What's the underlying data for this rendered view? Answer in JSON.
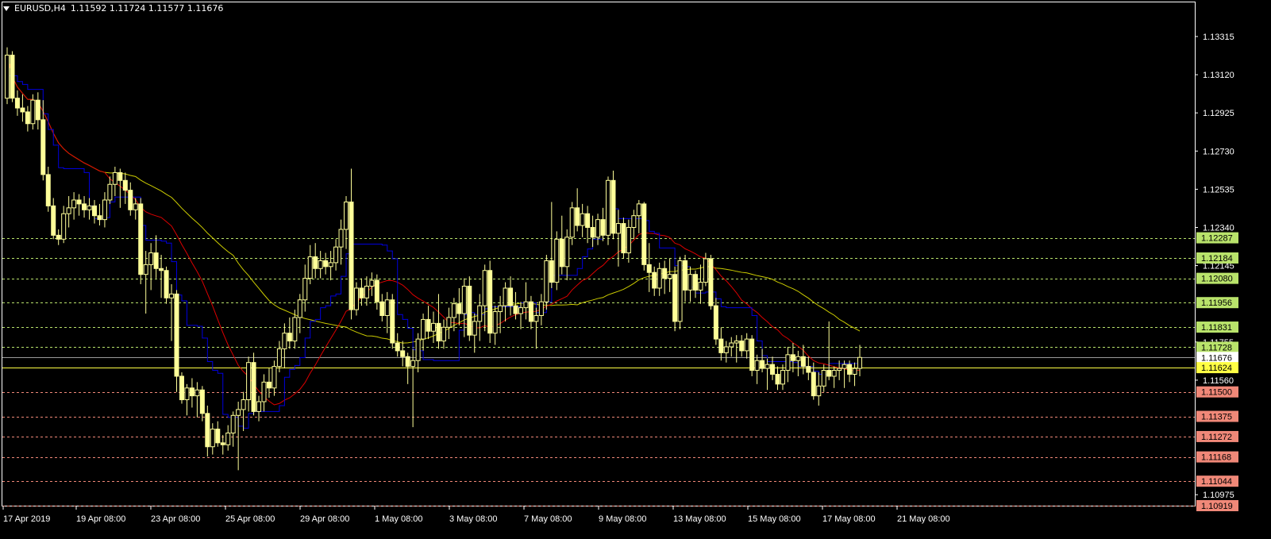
{
  "header": {
    "symbol": "EURUSD,H4",
    "ohlc": "1.11592 1.11724 1.11577 1.11676"
  },
  "colors": {
    "background": "#000000",
    "frame": "#ffffff",
    "candle": "#ffff99",
    "ma_fast": "#0000dd",
    "ma_mid": "#dd0000",
    "ma_slow": "#cccc00",
    "resistance": "#b9e36b",
    "support": "#f08878",
    "current_price": "#ffffff",
    "bid_line": "#ffff44"
  },
  "chart_data": {
    "type": "candlestick",
    "symbol": "EURUSD",
    "timeframe": "H4",
    "ylim": [
      1.10919,
      1.13315
    ],
    "grid": false,
    "price_axis_ticks": [
      "1.13315",
      "1.13120",
      "1.12925",
      "1.12730",
      "1.12535",
      "1.12340",
      "1.12145",
      "1.11755",
      "1.11560",
      "1.10975"
    ],
    "time_axis_labels": [
      "17 Apr 2019",
      "19 Apr 08:00",
      "23 Apr 08:00",
      "25 Apr 08:00",
      "29 Apr 08:00",
      "1 May 08:00",
      "3 May 08:00",
      "7 May 08:00",
      "9 May 08:00",
      "13 May 08:00",
      "15 May 08:00",
      "17 May 08:00",
      "21 May 08:00"
    ],
    "resistance_levels": [
      "1.12287",
      "1.12184",
      "1.12080",
      "1.11956",
      "1.11831",
      "1.11728"
    ],
    "support_levels": [
      "1.11500",
      "1.11375",
      "1.11272",
      "1.11168",
      "1.11044",
      "1.10919"
    ],
    "current_price": "1.11676",
    "bid_line": "1.11624",
    "candles": [
      [
        1.13,
        1.1326,
        1.1297,
        1.1322
      ],
      [
        1.1322,
        1.1324,
        1.1298,
        1.13
      ],
      [
        1.13,
        1.1304,
        1.1291,
        1.1295
      ],
      [
        1.1295,
        1.1302,
        1.1288,
        1.1293
      ],
      [
        1.1293,
        1.1296,
        1.1283,
        1.1287
      ],
      [
        1.1287,
        1.1302,
        1.1284,
        1.1299
      ],
      [
        1.1299,
        1.1303,
        1.1284,
        1.1289
      ],
      [
        1.1289,
        1.1299,
        1.1258,
        1.1261
      ],
      [
        1.1261,
        1.1265,
        1.1242,
        1.1245
      ],
      [
        1.1245,
        1.1249,
        1.1228,
        1.123
      ],
      [
        1.123,
        1.1233,
        1.1225,
        1.1228
      ],
      [
        1.1228,
        1.1245,
        1.1226,
        1.1241
      ],
      [
        1.1241,
        1.125,
        1.1234,
        1.1244
      ],
      [
        1.1244,
        1.1252,
        1.1238,
        1.1248
      ],
      [
        1.1248,
        1.1251,
        1.124,
        1.1246
      ],
      [
        1.1246,
        1.125,
        1.1239,
        1.1243
      ],
      [
        1.1243,
        1.1249,
        1.1238,
        1.1245
      ],
      [
        1.1245,
        1.1248,
        1.1236,
        1.124
      ],
      [
        1.124,
        1.1246,
        1.1235,
        1.1238
      ],
      [
        1.1238,
        1.1252,
        1.1234,
        1.1248
      ],
      [
        1.1248,
        1.126,
        1.1246,
        1.1256
      ],
      [
        1.1256,
        1.1265,
        1.125,
        1.1262
      ],
      [
        1.1262,
        1.1264,
        1.1244,
        1.1258
      ],
      [
        1.1258,
        1.1262,
        1.1246,
        1.1253
      ],
      [
        1.1253,
        1.1257,
        1.124,
        1.1243
      ],
      [
        1.1243,
        1.1249,
        1.1238,
        1.1246
      ],
      [
        1.1246,
        1.1249,
        1.1205,
        1.121
      ],
      [
        1.121,
        1.1222,
        1.119,
        1.1215
      ],
      [
        1.1215,
        1.1226,
        1.1202,
        1.1221
      ],
      [
        1.1221,
        1.123,
        1.1208,
        1.1213
      ],
      [
        1.1213,
        1.122,
        1.1198,
        1.1212
      ],
      [
        1.1212,
        1.1214,
        1.1195,
        1.1198
      ],
      [
        1.1198,
        1.1205,
        1.1176,
        1.12
      ],
      [
        1.12,
        1.1202,
        1.115,
        1.1158
      ],
      [
        1.1158,
        1.116,
        1.1144,
        1.1146
      ],
      [
        1.1146,
        1.1154,
        1.1138,
        1.1152
      ],
      [
        1.1152,
        1.1157,
        1.1142,
        1.1148
      ],
      [
        1.1148,
        1.1155,
        1.1137,
        1.1151
      ],
      [
        1.1151,
        1.1153,
        1.1135,
        1.1139
      ],
      [
        1.1139,
        1.1143,
        1.1117,
        1.1122
      ],
      [
        1.1122,
        1.1134,
        1.1118,
        1.1131
      ],
      [
        1.1131,
        1.1135,
        1.1122,
        1.1124
      ],
      [
        1.1124,
        1.1128,
        1.1118,
        1.1123
      ],
      [
        1.1123,
        1.1133,
        1.112,
        1.1129
      ],
      [
        1.1129,
        1.114,
        1.1122,
        1.1138
      ],
      [
        1.1138,
        1.1145,
        1.111,
        1.1141
      ],
      [
        1.1141,
        1.115,
        1.113,
        1.1146
      ],
      [
        1.1146,
        1.1168,
        1.114,
        1.1165
      ],
      [
        1.1165,
        1.117,
        1.1138,
        1.114
      ],
      [
        1.114,
        1.1148,
        1.1135,
        1.1145
      ],
      [
        1.1145,
        1.1159,
        1.114,
        1.1155
      ],
      [
        1.1155,
        1.1162,
        1.1147,
        1.1152
      ],
      [
        1.1152,
        1.1166,
        1.1148,
        1.1163
      ],
      [
        1.1163,
        1.1176,
        1.116,
        1.1172
      ],
      [
        1.1172,
        1.1185,
        1.1162,
        1.118
      ],
      [
        1.118,
        1.1188,
        1.1172,
        1.1176
      ],
      [
        1.1176,
        1.1192,
        1.1172,
        1.1188
      ],
      [
        1.1188,
        1.12,
        1.118,
        1.1197
      ],
      [
        1.1197,
        1.1215,
        1.1191,
        1.1208
      ],
      [
        1.1208,
        1.1225,
        1.1205,
        1.1219
      ],
      [
        1.1219,
        1.1226,
        1.1208,
        1.1213
      ],
      [
        1.1213,
        1.1222,
        1.1208,
        1.1217
      ],
      [
        1.1217,
        1.1221,
        1.121,
        1.1214
      ],
      [
        1.1214,
        1.1222,
        1.1207,
        1.1216
      ],
      [
        1.1216,
        1.1228,
        1.1212,
        1.1224
      ],
      [
        1.1224,
        1.1238,
        1.1215,
        1.1233
      ],
      [
        1.1233,
        1.125,
        1.1223,
        1.1247
      ],
      [
        1.1247,
        1.1264,
        1.1187,
        1.1192
      ],
      [
        1.1192,
        1.1206,
        1.1189,
        1.1203
      ],
      [
        1.1203,
        1.1208,
        1.1194,
        1.1198
      ],
      [
        1.1198,
        1.1209,
        1.1194,
        1.1204
      ],
      [
        1.1204,
        1.1211,
        1.1199,
        1.1207
      ],
      [
        1.1207,
        1.121,
        1.1192,
        1.1196
      ],
      [
        1.1196,
        1.12,
        1.1186,
        1.1189
      ],
      [
        1.1189,
        1.1201,
        1.118,
        1.1197
      ],
      [
        1.1197,
        1.12,
        1.1172,
        1.1175
      ],
      [
        1.1175,
        1.118,
        1.1168,
        1.1171
      ],
      [
        1.1171,
        1.1176,
        1.1163,
        1.1168
      ],
      [
        1.1168,
        1.117,
        1.1154,
        1.1163
      ],
      [
        1.1163,
        1.1172,
        1.1132,
        1.1166
      ],
      [
        1.1166,
        1.118,
        1.116,
        1.1177
      ],
      [
        1.1177,
        1.119,
        1.1171,
        1.1187
      ],
      [
        1.1187,
        1.1194,
        1.1177,
        1.1181
      ],
      [
        1.1181,
        1.1191,
        1.1175,
        1.1185
      ],
      [
        1.1185,
        1.12,
        1.1172,
        1.1176
      ],
      [
        1.1176,
        1.1187,
        1.1172,
        1.1183
      ],
      [
        1.1183,
        1.1193,
        1.1177,
        1.1188
      ],
      [
        1.1188,
        1.1198,
        1.1181,
        1.1195
      ],
      [
        1.1195,
        1.1203,
        1.1184,
        1.119
      ],
      [
        1.119,
        1.1208,
        1.1178,
        1.1204
      ],
      [
        1.1204,
        1.1209,
        1.1176,
        1.1179
      ],
      [
        1.1179,
        1.119,
        1.117,
        1.1186
      ],
      [
        1.1186,
        1.12,
        1.1176,
        1.1194
      ],
      [
        1.1194,
        1.1215,
        1.1181,
        1.1212
      ],
      [
        1.1212,
        1.1217,
        1.1175,
        1.118
      ],
      [
        1.118,
        1.1194,
        1.1174,
        1.1191
      ],
      [
        1.1191,
        1.1199,
        1.118,
        1.1194
      ],
      [
        1.1194,
        1.1206,
        1.1186,
        1.1203
      ],
      [
        1.1203,
        1.1209,
        1.1189,
        1.1194
      ],
      [
        1.1194,
        1.1201,
        1.1187,
        1.119
      ],
      [
        1.119,
        1.1196,
        1.1182,
        1.1193
      ],
      [
        1.1193,
        1.1206,
        1.1187,
        1.1196
      ],
      [
        1.1196,
        1.1199,
        1.1182,
        1.1186
      ],
      [
        1.1186,
        1.1193,
        1.1172,
        1.1189
      ],
      [
        1.1189,
        1.12,
        1.1184,
        1.1196
      ],
      [
        1.1196,
        1.122,
        1.1192,
        1.1217
      ],
      [
        1.1217,
        1.1247,
        1.1203,
        1.1206
      ],
      [
        1.1206,
        1.1232,
        1.1202,
        1.1228
      ],
      [
        1.1228,
        1.124,
        1.121,
        1.1214
      ],
      [
        1.1214,
        1.1233,
        1.1207,
        1.1229
      ],
      [
        1.1229,
        1.1247,
        1.1225,
        1.1244
      ],
      [
        1.1244,
        1.1254,
        1.1232,
        1.1235
      ],
      [
        1.1235,
        1.1246,
        1.1229,
        1.1241
      ],
      [
        1.1241,
        1.1245,
        1.1226,
        1.1234
      ],
      [
        1.1234,
        1.124,
        1.1224,
        1.1229
      ],
      [
        1.1229,
        1.1241,
        1.1225,
        1.1238
      ],
      [
        1.1238,
        1.1244,
        1.1227,
        1.123
      ],
      [
        1.123,
        1.126,
        1.1225,
        1.1258
      ],
      [
        1.1258,
        1.1263,
        1.1228,
        1.1231
      ],
      [
        1.1231,
        1.1243,
        1.1214,
        1.1236
      ],
      [
        1.1236,
        1.1239,
        1.1218,
        1.1221
      ],
      [
        1.1221,
        1.1238,
        1.1216,
        1.1234
      ],
      [
        1.1234,
        1.1243,
        1.1228,
        1.124
      ],
      [
        1.124,
        1.1248,
        1.1231,
        1.1246
      ],
      [
        1.1246,
        1.1247,
        1.1212,
        1.1215
      ],
      [
        1.1215,
        1.1226,
        1.1201,
        1.1211
      ],
      [
        1.1211,
        1.1214,
        1.1199,
        1.1203
      ],
      [
        1.1203,
        1.1216,
        1.1199,
        1.1213
      ],
      [
        1.1213,
        1.1217,
        1.12,
        1.1208
      ],
      [
        1.1208,
        1.1218,
        1.1201,
        1.121
      ],
      [
        1.121,
        1.1214,
        1.1181,
        1.1186
      ],
      [
        1.1186,
        1.1219,
        1.1182,
        1.1217
      ],
      [
        1.1217,
        1.122,
        1.1196,
        1.1202
      ],
      [
        1.1202,
        1.1214,
        1.1196,
        1.121
      ],
      [
        1.121,
        1.1212,
        1.1198,
        1.1202
      ],
      [
        1.1202,
        1.1215,
        1.1195,
        1.1206
      ],
      [
        1.1206,
        1.1221,
        1.1204,
        1.1218
      ],
      [
        1.1218,
        1.122,
        1.1192,
        1.1194
      ],
      [
        1.1194,
        1.1198,
        1.1174,
        1.1177
      ],
      [
        1.1177,
        1.1183,
        1.1166,
        1.117
      ],
      [
        1.117,
        1.1176,
        1.1165,
        1.1173
      ],
      [
        1.1173,
        1.1178,
        1.1168,
        1.1175
      ],
      [
        1.1175,
        1.1179,
        1.1165,
        1.1176
      ],
      [
        1.1176,
        1.1179,
        1.1168,
        1.1171
      ],
      [
        1.1171,
        1.118,
        1.1167,
        1.1177
      ],
      [
        1.1177,
        1.1179,
        1.1158,
        1.1161
      ],
      [
        1.1161,
        1.1169,
        1.1154,
        1.1166
      ],
      [
        1.1166,
        1.1172,
        1.116,
        1.1162
      ],
      [
        1.1162,
        1.1167,
        1.1151,
        1.1164
      ],
      [
        1.1164,
        1.1168,
        1.1156,
        1.1159
      ],
      [
        1.1159,
        1.1163,
        1.1151,
        1.1154
      ],
      [
        1.1154,
        1.1164,
        1.1151,
        1.1161
      ],
      [
        1.1161,
        1.1173,
        1.1155,
        1.1169
      ],
      [
        1.1169,
        1.1175,
        1.116,
        1.1166
      ],
      [
        1.1166,
        1.1171,
        1.1158,
        1.1168
      ],
      [
        1.1168,
        1.1174,
        1.1159,
        1.1163
      ],
      [
        1.1163,
        1.1168,
        1.1156,
        1.116
      ],
      [
        1.116,
        1.1165,
        1.1146,
        1.1148
      ],
      [
        1.1148,
        1.116,
        1.1143,
        1.1153
      ],
      [
        1.1153,
        1.1164,
        1.115,
        1.1161
      ],
      [
        1.1161,
        1.1186,
        1.1156,
        1.1158
      ],
      [
        1.1158,
        1.1163,
        1.1152,
        1.1161
      ],
      [
        1.1161,
        1.1166,
        1.1156,
        1.1162
      ],
      [
        1.1162,
        1.1166,
        1.1152,
        1.1164
      ],
      [
        1.1164,
        1.1166,
        1.1155,
        1.1159
      ],
      [
        1.1159,
        1.1165,
        1.1153,
        1.1162
      ],
      [
        1.1162,
        1.1174,
        1.1158,
        1.11676
      ]
    ],
    "ma_fast": [
      1.1289,
      1.1289,
      1.1289,
      1.1289,
      1.1289,
      1.1289,
      1.1289,
      1.1289,
      1.1289,
      1.1289,
      1.1289,
      1.1289,
      1.1289,
      1.1289,
      1.1289,
      1.1289,
      1.1289,
      1.1289,
      1.1289,
      1.1289,
      1.1289,
      1.1289,
      1.1289,
      1.1289,
      1.1289,
      1.1289,
      1.1289,
      1.1289,
      1.1289,
      1.1289,
      1.1289,
      1.1289,
      1.1289,
      1.1289,
      1.1289,
      1.1289,
      1.1289,
      1.1289,
      1.1289,
      1.1289
    ],
    "ma_mid": [],
    "ma_slow": []
  }
}
